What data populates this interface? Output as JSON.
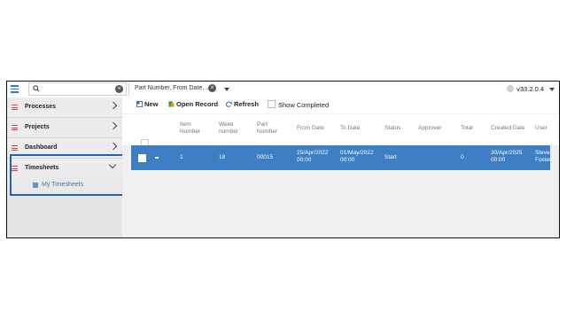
{
  "topbar": {
    "search_placeholder": "",
    "filter_text": "Part Number, From Date, ...",
    "version": "v33.2.0.4"
  },
  "sidebar": {
    "items": [
      {
        "label": "Processes",
        "expanded": false
      },
      {
        "label": "Projects",
        "expanded": false
      },
      {
        "label": "Dashboard",
        "expanded": false
      },
      {
        "label": "Timesheets",
        "expanded": true
      }
    ],
    "sub_item": "My Timesheets"
  },
  "toolbar": {
    "new_label": "New",
    "open_label": "Open Record",
    "refresh_label": "Refresh",
    "show_completed_label": "Show Completed"
  },
  "table": {
    "headers": [
      "Item Number",
      "Week number",
      "Part Number",
      "From Date",
      "To Date",
      "Status",
      "Approver",
      "Total",
      "Created Date",
      "User"
    ],
    "rows": [
      {
        "item_number": "1",
        "week_number": "18",
        "part_number": "00015",
        "from_date": "25/Apr/2022 00:00",
        "to_date": "01/May/2022 00:00",
        "status": "Start",
        "approver": "",
        "total": "0",
        "created_date": "30/Apr/2025 00:00",
        "user": "Steve Foster"
      }
    ]
  },
  "colors": {
    "accent": "#3d7ec4",
    "highlight_border": "#1c67b0",
    "menu_icon": "#d94040"
  }
}
